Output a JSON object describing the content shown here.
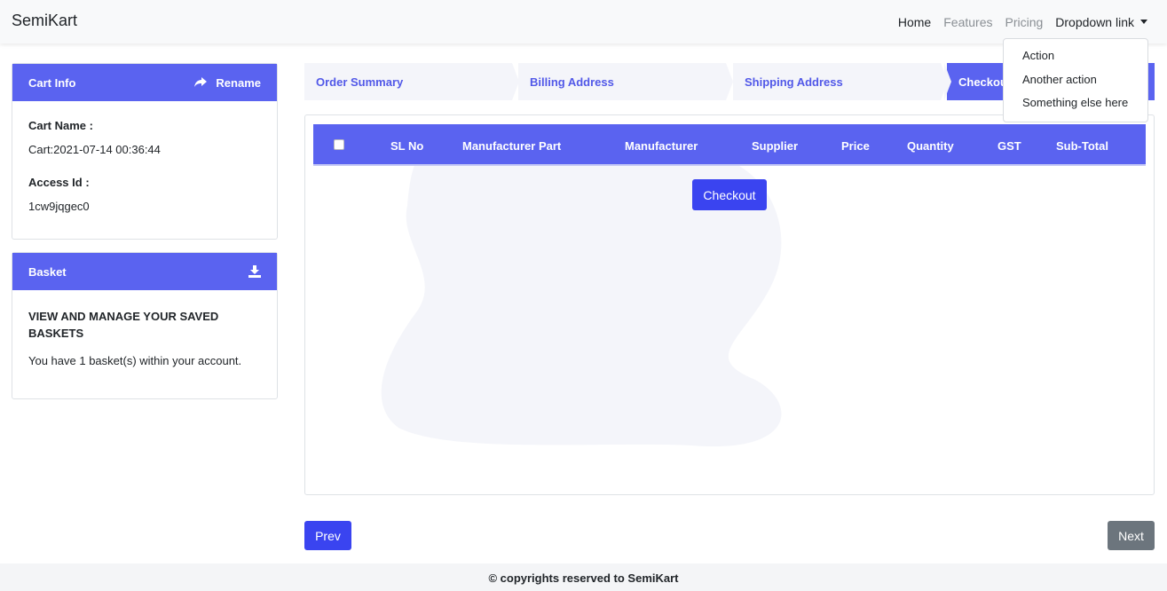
{
  "navbar": {
    "brand": "SemiKart",
    "links": [
      "Home",
      "Features",
      "Pricing"
    ],
    "dropdown_label": "Dropdown link",
    "dropdown_items": [
      "Action",
      "Another action",
      "Something else here"
    ]
  },
  "cart_info": {
    "header": "Cart Info",
    "rename_label": "Rename",
    "cart_name_label": "Cart Name :",
    "cart_name_value": "Cart:2021-07-14 00:36:44",
    "access_id_label": "Access Id :",
    "access_id_value": "1cw9jqgec0"
  },
  "basket": {
    "header": "Basket",
    "title": "VIEW AND MANAGE YOUR SAVED BASKETS",
    "text": "You have 1 basket(s) within your account."
  },
  "steps": [
    "Order Summary",
    "Billing Address",
    "Shipping Address",
    "Checkout"
  ],
  "table": {
    "columns": [
      "SL No",
      "Manufacturer Part",
      "Manufacturer",
      "Supplier",
      "Price",
      "Quantity",
      "GST",
      "Sub-Total"
    ]
  },
  "checkout_button": "Checkout",
  "prev_button": "Prev",
  "next_button": "Next",
  "footer": "© copyrights reserved to SemiKart",
  "colors": {
    "primary": "#5a63f0",
    "button": "#3a44f0",
    "secondary": "#6c757d"
  }
}
